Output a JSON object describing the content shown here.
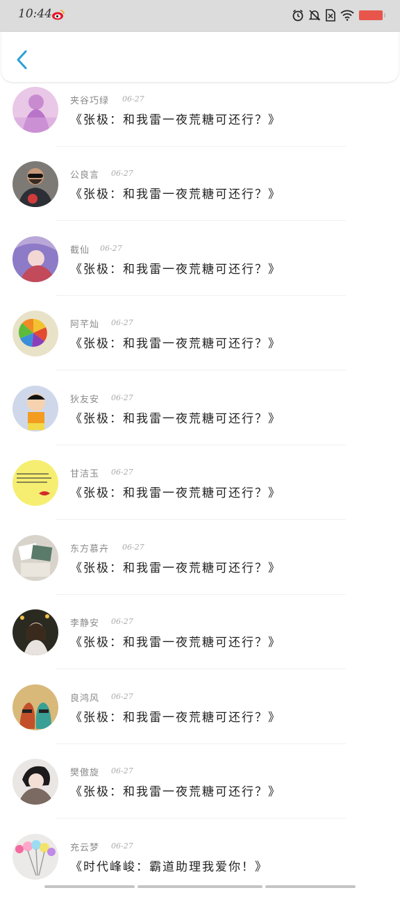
{
  "status_bar": {
    "time": "10:44",
    "icons": [
      "weibo-icon",
      "alarm-icon",
      "mute-icon",
      "sim-icon",
      "wifi-icon",
      "battery-icon"
    ],
    "battery_color": "#e8554b"
  },
  "header": {
    "back_icon": "chevron-left-icon",
    "accent": "#2a9fd6"
  },
  "items": [
    {
      "name": "夹谷巧绿",
      "date": "06-27",
      "title": "《张极：和我雷一夜荒糖可还行？》",
      "avatar": "purple-figure"
    },
    {
      "name": "公良言",
      "date": "06-27",
      "title": "《张极：和我雷一夜荒糖可还行？》",
      "avatar": "man-sunglasses"
    },
    {
      "name": "截仙",
      "date": "06-27",
      "title": "《张极：和我雷一夜荒糖可还行？》",
      "avatar": "anime-girl-purple"
    },
    {
      "name": "阿芊灿",
      "date": "06-27",
      "title": "《张极：和我雷一夜荒糖可还行？》",
      "avatar": "citrus-slice"
    },
    {
      "name": "狄友安",
      "date": "06-27",
      "title": "《张极：和我雷一夜荒糖可还行？》",
      "avatar": "cartoon-boy"
    },
    {
      "name": "甘洁玉",
      "date": "06-27",
      "title": "《张极：和我雷一夜荒糖可还行？》",
      "avatar": "yellow-note-lips"
    },
    {
      "name": "东方慕卉",
      "date": "06-27",
      "title": "《张极：和我雷一夜荒糖可还行？》",
      "avatar": "photos-pile"
    },
    {
      "name": "李静安",
      "date": "06-27",
      "title": "《张极：和我雷一夜荒糖可还行？》",
      "avatar": "girl-night"
    },
    {
      "name": "良鸿风",
      "date": "06-27",
      "title": "《张极：和我雷一夜荒糖可还行？》",
      "avatar": "gemini-sign"
    },
    {
      "name": "樊傲旋",
      "date": "06-27",
      "title": "《张极：和我雷一夜荒糖可还行？》",
      "avatar": "girl-scarf"
    },
    {
      "name": "充云梦",
      "date": "06-27",
      "title": "《时代峰峻：霸道助理我爱你！》",
      "avatar": "colorful-pompoms"
    }
  ]
}
